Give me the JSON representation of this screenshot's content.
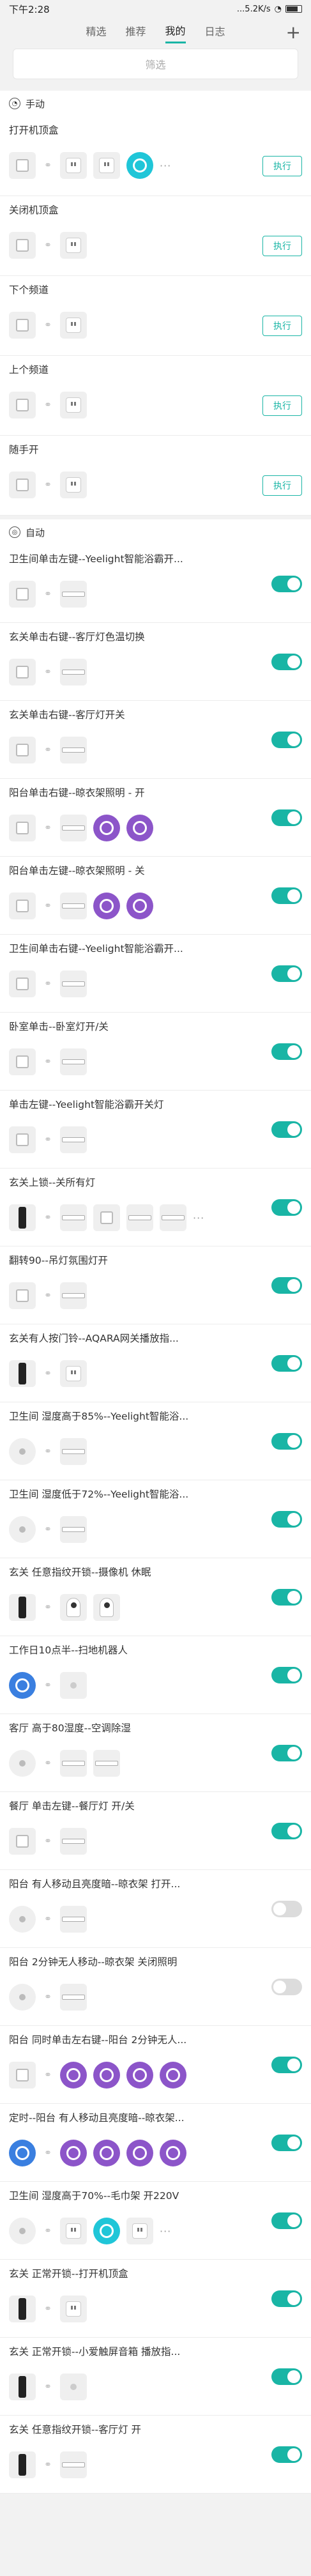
{
  "status": {
    "time": "下午2:28",
    "network": "...5.2K/s"
  },
  "tabs": [
    {
      "label": "精选",
      "active": false
    },
    {
      "label": "推荐",
      "active": false
    },
    {
      "label": "我的",
      "active": true
    },
    {
      "label": "日志",
      "active": false
    }
  ],
  "filter_label": "筛选",
  "manual": {
    "title": "手动",
    "exec_label": "执行",
    "items": [
      {
        "title": "打开机顶盒",
        "icons": [
          "switch",
          "link",
          "socket",
          "socket",
          "teal",
          "more"
        ]
      },
      {
        "title": "关闭机顶盒",
        "icons": [
          "switch",
          "link",
          "socket"
        ]
      },
      {
        "title": "下个频道",
        "icons": [
          "switch",
          "link",
          "socket"
        ]
      },
      {
        "title": "上个频道",
        "icons": [
          "switch",
          "link",
          "socket"
        ]
      },
      {
        "title": "随手开",
        "icons": [
          "switch",
          "link",
          "socket"
        ]
      }
    ]
  },
  "auto": {
    "title": "自动",
    "items": [
      {
        "title": "卫生间单击左键--Yeelight智能浴霸开...",
        "on": true,
        "icons": [
          "switch",
          "link",
          "bar"
        ]
      },
      {
        "title": "玄关单击右键--客厅灯色温切换",
        "on": true,
        "icons": [
          "switch",
          "link",
          "bar"
        ]
      },
      {
        "title": "玄关单击右键--客厅灯开关",
        "on": true,
        "icons": [
          "switch",
          "link",
          "bar"
        ]
      },
      {
        "title": "阳台单击右键--晾衣架照明 - 开",
        "on": true,
        "icons": [
          "switch",
          "link",
          "bar",
          "purple",
          "purple"
        ]
      },
      {
        "title": "阳台单击左键--晾衣架照明 - 关",
        "on": true,
        "icons": [
          "switch",
          "link",
          "bar",
          "purple",
          "purple"
        ]
      },
      {
        "title": "卫生间单击右键--Yeelight智能浴霸开...",
        "on": true,
        "icons": [
          "switch",
          "link",
          "bar"
        ]
      },
      {
        "title": "卧室单击--卧室灯开/关",
        "on": true,
        "icons": [
          "switch",
          "link",
          "bar"
        ]
      },
      {
        "title": "单击左键--Yeelight智能浴霸开关灯",
        "on": true,
        "icons": [
          "switch",
          "link",
          "bar"
        ]
      },
      {
        "title": "玄关上锁--关所有灯",
        "on": true,
        "icons": [
          "lock",
          "link",
          "bar",
          "switch",
          "bar",
          "bar",
          "more"
        ]
      },
      {
        "title": "翻转90--吊灯氛围灯开",
        "on": true,
        "icons": [
          "switch",
          "link",
          "bar"
        ]
      },
      {
        "title": "玄关有人按门铃--AQARA网关播放指...",
        "on": true,
        "icons": [
          "lock",
          "link",
          "socket"
        ]
      },
      {
        "title": "卫生间 湿度高于85%--Yeelight智能浴...",
        "on": true,
        "icons": [
          "sensor",
          "link",
          "bar"
        ]
      },
      {
        "title": "卫生间 湿度低于72%--Yeelight智能浴...",
        "on": true,
        "icons": [
          "sensor",
          "link",
          "bar"
        ]
      },
      {
        "title": "玄关 任意指纹开锁--摄像机 休眠",
        "on": true,
        "icons": [
          "lock",
          "link",
          "cam",
          "cam"
        ]
      },
      {
        "title": "工作日10点半--扫地机器人",
        "on": true,
        "icons": [
          "blue",
          "link",
          "dev"
        ]
      },
      {
        "title": "客厅 高于80湿度--空调除湿",
        "on": true,
        "icons": [
          "sensor",
          "link",
          "bar",
          "bar"
        ]
      },
      {
        "title": "餐厅 单击左键--餐厅灯 开/关",
        "on": true,
        "icons": [
          "switch",
          "link",
          "bar"
        ]
      },
      {
        "title": "阳台 有人移动且亮度暗--晾衣架 打开...",
        "on": false,
        "icons": [
          "sensor",
          "link",
          "bar"
        ]
      },
      {
        "title": "阳台 2分钟无人移动--晾衣架 关闭照明",
        "on": false,
        "icons": [
          "sensor",
          "link",
          "bar"
        ]
      },
      {
        "title": "阳台 同时单击左右键--阳台 2分钟无人...",
        "on": true,
        "icons": [
          "switch",
          "link",
          "purple",
          "purple",
          "purple",
          "purple"
        ]
      },
      {
        "title": "定时--阳台 有人移动且亮度暗--晾衣架...",
        "on": true,
        "icons": [
          "blue",
          "link",
          "purple",
          "purple",
          "purple",
          "purple"
        ]
      },
      {
        "title": "卫生间 湿度高于70%--毛巾架 开220V",
        "on": true,
        "icons": [
          "sensor",
          "link",
          "socket",
          "teal",
          "socket",
          "more"
        ]
      },
      {
        "title": "玄关 正常开锁--打开机顶盒",
        "on": true,
        "icons": [
          "lock",
          "link",
          "socket"
        ]
      },
      {
        "title": "玄关 正常开锁--小爱触屏音箱 播放指...",
        "on": true,
        "icons": [
          "lock",
          "link",
          "dev"
        ]
      },
      {
        "title": "玄关 任意指纹开锁--客厅灯 开",
        "on": true,
        "icons": [
          "lock",
          "link",
          "bar"
        ]
      }
    ]
  }
}
